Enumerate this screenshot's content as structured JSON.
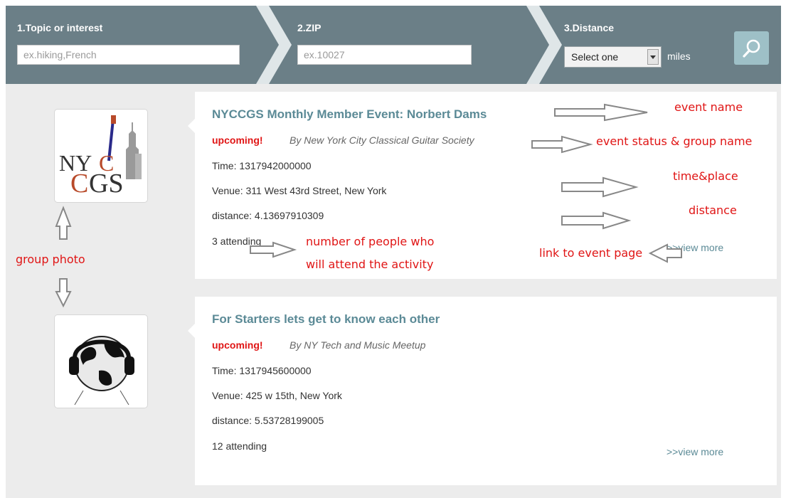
{
  "search": {
    "topic_label": "1.Topic or interest",
    "topic_placeholder": "ex.hiking,French",
    "zip_label": "2.ZIP",
    "zip_placeholder": "ex.10027",
    "distance_label": "3.Distance",
    "distance_selected": "Select one",
    "distance_unit": "miles",
    "search_icon": "search-icon"
  },
  "events": [
    {
      "name": "NYCCGS Monthly Member Event: Norbert Dams",
      "status": "upcoming!",
      "group": "By New York City Classical Guitar Society",
      "time": "Time: 1317942000000",
      "venue": "Venue: 311 West 43rd Street, New York",
      "distance": "distance: 4.13697910309",
      "attending": "3 attending",
      "view_more": ">>view more",
      "photo_icon": "nyccgs-logo"
    },
    {
      "name": "For Starters lets get to know each other",
      "status": "upcoming!",
      "group": "By NY Tech and Music Meetup",
      "time": "Time: 1317945600000",
      "venue": "Venue: 425 w 15th, New York",
      "distance": "distance: 5.53728199005",
      "attending": "12 attending",
      "view_more": ">>view more",
      "photo_icon": "globe-headphones-icon"
    }
  ],
  "annotations": {
    "event_name": "event name",
    "status_group": "event status & group name",
    "time_place": "time&place",
    "distance": "distance",
    "attendees_line1": "number of people who",
    "attendees_line2": "will attend the activity",
    "link": "link to event page",
    "group_photo": "group photo"
  },
  "colors": {
    "header_bg": "#6b7f87",
    "content_bg": "#ececec",
    "event_name": "#5b8a96",
    "status": "#e01515",
    "annotation": "#e01515",
    "search_button": "#9ec0c7"
  }
}
